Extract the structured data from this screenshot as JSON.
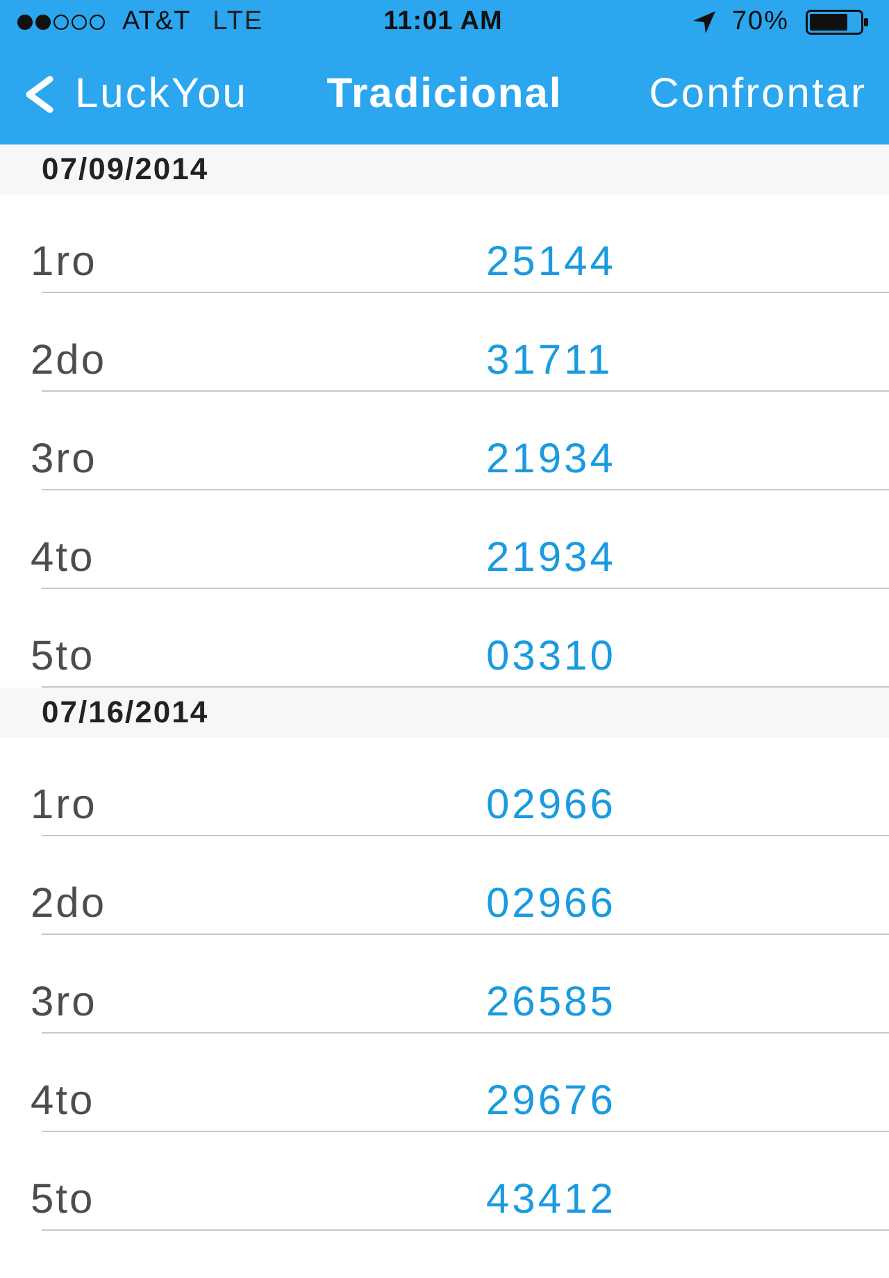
{
  "status_bar": {
    "carrier": "AT&T",
    "network": "LTE",
    "time": "11:01 AM",
    "battery": "70%"
  },
  "nav_bar": {
    "back": "LuckYou",
    "title": "Tradicional",
    "action": "Confrontar"
  },
  "sections": [
    {
      "date": "07/09/2014",
      "rows": [
        {
          "place": "1ro",
          "number": "25144"
        },
        {
          "place": "2do",
          "number": "31711"
        },
        {
          "place": "3ro",
          "number": "21934"
        },
        {
          "place": "4to",
          "number": "21934"
        },
        {
          "place": "5to",
          "number": "03310"
        }
      ]
    },
    {
      "date": "07/16/2014",
      "rows": [
        {
          "place": "1ro",
          "number": "02966"
        },
        {
          "place": "2do",
          "number": "02966"
        },
        {
          "place": "3ro",
          "number": "26585"
        },
        {
          "place": "4to",
          "number": "29676"
        },
        {
          "place": "5to",
          "number": "43412"
        }
      ]
    }
  ]
}
